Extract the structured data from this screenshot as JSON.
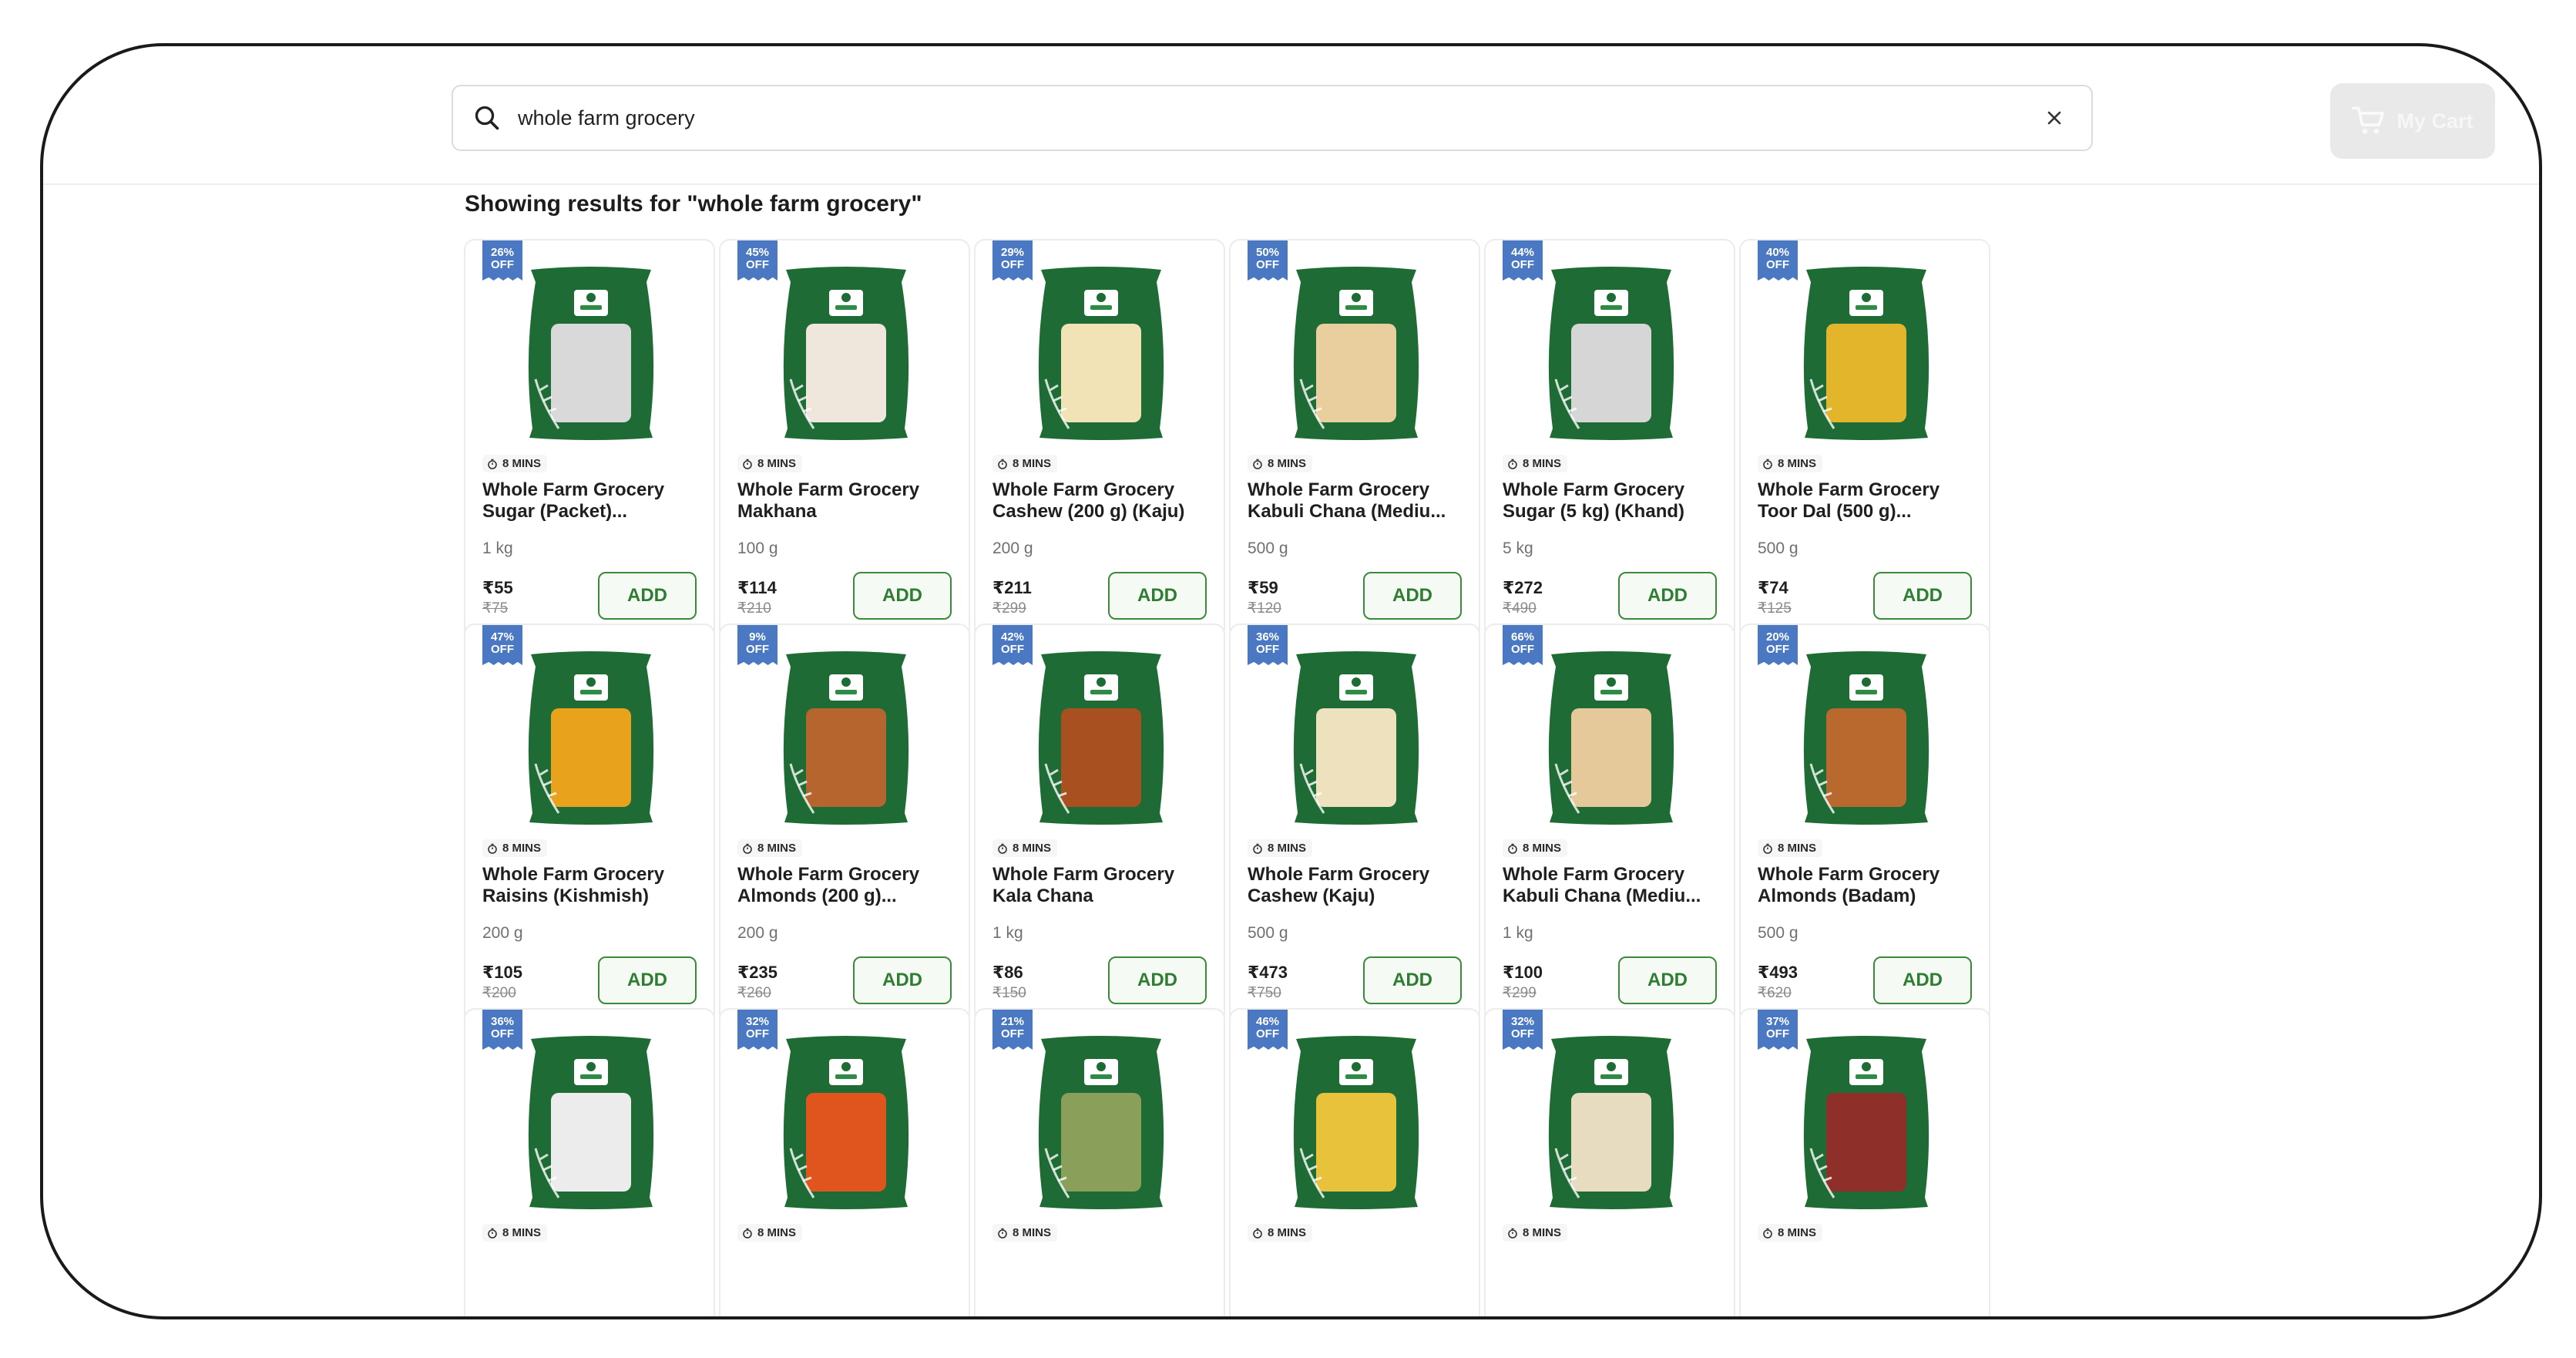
{
  "search": {
    "value": "whole farm grocery"
  },
  "cart": {
    "label": "My Cart"
  },
  "results_title": "Showing results for \"whole farm grocery\"",
  "colors": {
    "pack_green": "#1f6b35",
    "badge_blue": "#4a78c2",
    "add_green": "#2e7d32"
  },
  "products": [
    {
      "discount": "26%",
      "off": "OFF",
      "eta": "8 MINS",
      "name": "Whole Farm Grocery Sugar (Packet)...",
      "qty": "1 kg",
      "price": "₹55",
      "mrp": "₹75",
      "add": "ADD",
      "fill": "#d9d9d9"
    },
    {
      "discount": "45%",
      "off": "OFF",
      "eta": "8 MINS",
      "name": "Whole Farm Grocery Makhana",
      "qty": "100 g",
      "price": "₹114",
      "mrp": "₹210",
      "add": "ADD",
      "fill": "#efe7dc"
    },
    {
      "discount": "29%",
      "off": "OFF",
      "eta": "8 MINS",
      "name": "Whole Farm Grocery Cashew (200 g) (Kaju)",
      "qty": "200 g",
      "price": "₹211",
      "mrp": "₹299",
      "add": "ADD",
      "fill": "#f1e3b6"
    },
    {
      "discount": "50%",
      "off": "OFF",
      "eta": "8 MINS",
      "name": "Whole Farm Grocery Kabuli Chana (Mediu...",
      "qty": "500 g",
      "price": "₹59",
      "mrp": "₹120",
      "add": "ADD",
      "fill": "#e9cf9e"
    },
    {
      "discount": "44%",
      "off": "OFF",
      "eta": "8 MINS",
      "name": "Whole Farm Grocery Sugar (5 kg) (Khand)",
      "qty": "5 kg",
      "price": "₹272",
      "mrp": "₹490",
      "add": "ADD",
      "fill": "#d6d6d6"
    },
    {
      "discount": "40%",
      "off": "OFF",
      "eta": "8 MINS",
      "name": "Whole Farm Grocery Toor Dal (500 g)...",
      "qty": "500 g",
      "price": "₹74",
      "mrp": "₹125",
      "add": "ADD",
      "fill": "#e3b52a"
    },
    {
      "discount": "47%",
      "off": "OFF",
      "eta": "8 MINS",
      "name": "Whole Farm Grocery Raisins (Kishmish)",
      "qty": "200 g",
      "price": "₹105",
      "mrp": "₹200",
      "add": "ADD",
      "fill": "#e8a21c"
    },
    {
      "discount": "9%",
      "off": "OFF",
      "eta": "8 MINS",
      "name": "Whole Farm Grocery Almonds (200 g)...",
      "qty": "200 g",
      "price": "₹235",
      "mrp": "₹260",
      "add": "ADD",
      "fill": "#b5652d"
    },
    {
      "discount": "42%",
      "off": "OFF",
      "eta": "8 MINS",
      "name": "Whole Farm Grocery Kala Chana",
      "qty": "1 kg",
      "price": "₹86",
      "mrp": "₹150",
      "add": "ADD",
      "fill": "#a8501f"
    },
    {
      "discount": "36%",
      "off": "OFF",
      "eta": "8 MINS",
      "name": "Whole Farm Grocery Cashew (Kaju)",
      "qty": "500 g",
      "price": "₹473",
      "mrp": "₹750",
      "add": "ADD",
      "fill": "#eee1bd"
    },
    {
      "discount": "66%",
      "off": "OFF",
      "eta": "8 MINS",
      "name": "Whole Farm Grocery Kabuli Chana (Mediu...",
      "qty": "1 kg",
      "price": "₹100",
      "mrp": "₹299",
      "add": "ADD",
      "fill": "#e6c99a"
    },
    {
      "discount": "20%",
      "off": "OFF",
      "eta": "8 MINS",
      "name": "Whole Farm Grocery Almonds (Badam)",
      "qty": "500 g",
      "price": "₹493",
      "mrp": "₹620",
      "add": "ADD",
      "fill": "#b9692e"
    },
    {
      "discount": "36%",
      "off": "OFF",
      "eta": "8 MINS",
      "name": "",
      "qty": "",
      "price": "",
      "mrp": "",
      "add": "",
      "fill": "#ececec"
    },
    {
      "discount": "32%",
      "off": "OFF",
      "eta": "8 MINS",
      "name": "",
      "qty": "",
      "price": "",
      "mrp": "",
      "add": "",
      "fill": "#e0551e"
    },
    {
      "discount": "21%",
      "off": "OFF",
      "eta": "8 MINS",
      "name": "",
      "qty": "",
      "price": "",
      "mrp": "",
      "add": "",
      "fill": "#8aa05a"
    },
    {
      "discount": "46%",
      "off": "OFF",
      "eta": "8 MINS",
      "name": "",
      "qty": "",
      "price": "",
      "mrp": "",
      "add": "",
      "fill": "#e8c23a"
    },
    {
      "discount": "32%",
      "off": "OFF",
      "eta": "8 MINS",
      "name": "",
      "qty": "",
      "price": "",
      "mrp": "",
      "add": "",
      "fill": "#e8dcc0"
    },
    {
      "discount": "37%",
      "off": "OFF",
      "eta": "8 MINS",
      "name": "",
      "qty": "",
      "price": "",
      "mrp": "",
      "add": "",
      "fill": "#8e2f2a"
    }
  ]
}
